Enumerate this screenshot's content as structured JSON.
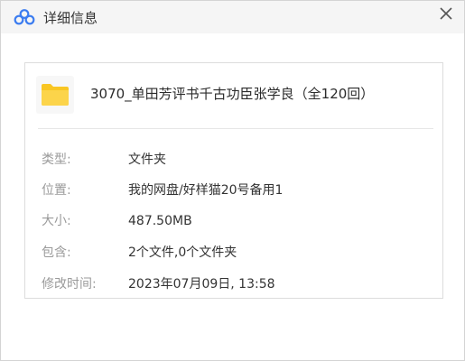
{
  "window": {
    "title": "详细信息"
  },
  "file": {
    "name": "3070_单田芳评书千古功臣张学良（全120回）",
    "icon": "folder-icon"
  },
  "details": [
    {
      "label": "类型:",
      "value": "文件夹"
    },
    {
      "label": "位置:",
      "value": "我的网盘/好样猫20号备用1"
    },
    {
      "label": "大小:",
      "value": "487.50MB"
    },
    {
      "label": "包含:",
      "value": "2个文件,0个文件夹"
    },
    {
      "label": "修改时间:",
      "value": "2023年07月09日, 13:58"
    }
  ],
  "colors": {
    "folder": "#f9c623",
    "logo_primary": "#3b7cf0"
  }
}
